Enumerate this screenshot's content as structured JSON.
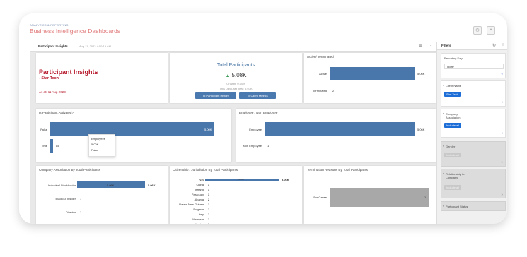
{
  "header": {
    "breadcrumb": "ANALYTICS & REPORTING",
    "title": "Business Intelligence Dashboards",
    "clock_icon": "clock-icon",
    "close_icon": "close-icon"
  },
  "dashboard": {
    "title": "Participant Insights",
    "timestamp": "Aug 11, 2023 4:50:19 AM",
    "toolbar_icons": [
      "table-icon",
      "more-icon"
    ]
  },
  "insights_card": {
    "title": "Participant Insights",
    "subtitle": "- Star Tech",
    "as_at": "As at: 11 Aug 2023"
  },
  "total_participants": {
    "title": "Total Participants",
    "value": "5.08K",
    "growth": "Growth: 0.00%",
    "last_year": "This Day Last Year: 5.07K",
    "history_button": "To Participant History",
    "metrics_button": "To Client Metrics",
    "trend_color": "#3a9a55"
  },
  "active_terminated": {
    "title": "Active/ Terminated",
    "rows": [
      {
        "label": "Active",
        "value": "5.06K",
        "num": 5060
      },
      {
        "label": "Terminated",
        "value": "2",
        "num": 2
      }
    ]
  },
  "activated": {
    "title": "Is Participant Activated?",
    "rows": [
      {
        "label": "False",
        "value": "5.00K",
        "num": 5000
      },
      {
        "label": "True",
        "value": "85",
        "num": 85
      }
    ],
    "tooltip": {
      "series": "Employees",
      "value": "5.00K",
      "category": "False"
    }
  },
  "employee": {
    "title": "Employee / Non Employee",
    "rows": [
      {
        "label": "Employee",
        "value": "5.06K",
        "num": 5060
      },
      {
        "label": "Non Employee",
        "value": "1",
        "num": 1
      }
    ]
  },
  "company_assoc": {
    "title": "Company Association By Total Participants",
    "rows": [
      {
        "label": "Individual Stockholder",
        "value": "5.06K",
        "inner": "5.06K",
        "num": 5060
      },
      {
        "label": "Blackout Insider",
        "value": "1",
        "num": 1
      },
      {
        "label": "Director",
        "value": "1",
        "num": 1
      }
    ]
  },
  "citizenship": {
    "title": "Citizenship / Jurisdiction By Total Participants",
    "rows": [
      {
        "label": "N/A",
        "value": "5.06K",
        "inner": "5.06K",
        "num": 5060
      },
      {
        "label": "China",
        "value": "3",
        "num": 3
      },
      {
        "label": "Ireland",
        "value": "3",
        "num": 3
      },
      {
        "label": "Paraguay",
        "value": "3",
        "num": 3
      },
      {
        "label": "Albania",
        "value": "2",
        "num": 2
      },
      {
        "label": "Papua New Guinea",
        "value": "2",
        "num": 2
      },
      {
        "label": "Bulgaria",
        "value": "1",
        "num": 1
      },
      {
        "label": "Italy",
        "value": "1",
        "num": 1
      },
      {
        "label": "Malaysia",
        "value": "1",
        "num": 1
      },
      {
        "label": "Mexico",
        "value": "1",
        "num": 1
      }
    ]
  },
  "termination": {
    "title": "Termination Reasons By Total Participants",
    "rows": [
      {
        "label": "For Cause",
        "value": "1",
        "num": 1
      }
    ]
  },
  "filters": {
    "title": "Filters",
    "reporting_day": {
      "label": "Reporting Day",
      "value": "Today"
    },
    "client_name": {
      "label": "Client Name",
      "tag": "Star Tech"
    },
    "company_association": {
      "label": "Company Association",
      "tag": "Include all"
    },
    "gender": {
      "label": "Gender",
      "tag": "Include all"
    },
    "relationship": {
      "label": "Relationship to Company",
      "tag": "Include all"
    },
    "participant_status": {
      "label": "Participant Status"
    }
  }
}
